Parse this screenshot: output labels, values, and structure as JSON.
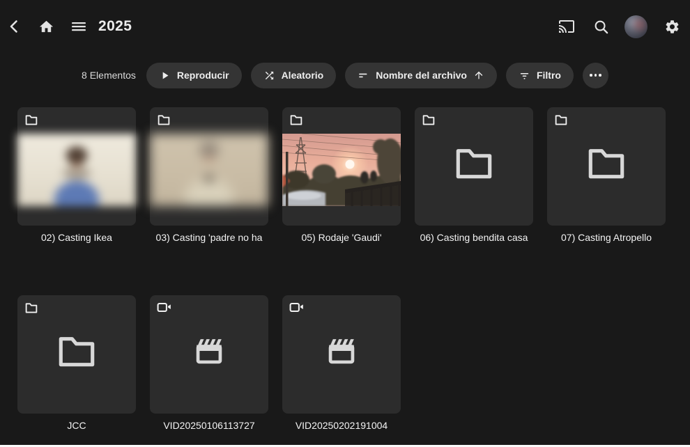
{
  "header": {
    "title": "2025",
    "icons": [
      "back-icon",
      "home-icon",
      "menu-icon",
      "cast-icon",
      "search-icon",
      "avatar",
      "settings-icon"
    ]
  },
  "toolbar": {
    "count": "8 Elementos",
    "play": "Reproducir",
    "shuffle": "Aleatorio",
    "sort": "Nombre del archivo",
    "filter": "Filtro",
    "more": "more-options"
  },
  "items": [
    {
      "label": "02) Casting Ikea",
      "type": "folder",
      "thumb": "person-blue"
    },
    {
      "label": "03) Casting 'padre no ha",
      "type": "folder",
      "thumb": "person-beige"
    },
    {
      "label": "05) Rodaje 'Gaudi'",
      "type": "folder",
      "thumb": "sunset"
    },
    {
      "label": "06) Casting bendita casa",
      "type": "folder",
      "thumb": null
    },
    {
      "label": "07) Casting Atropello",
      "type": "folder",
      "thumb": null
    },
    {
      "label": "JCC",
      "type": "folder",
      "thumb": null
    },
    {
      "label": "VID20250106113727",
      "type": "video",
      "thumb": null
    },
    {
      "label": "VID20250202191004",
      "type": "video",
      "thumb": null
    }
  ],
  "colors": {
    "page_bg": "#191919",
    "tile_bg": "#2c2c2c",
    "button_bg": "#343434",
    "text": "#ededed",
    "icon": "#e3e3e3"
  }
}
